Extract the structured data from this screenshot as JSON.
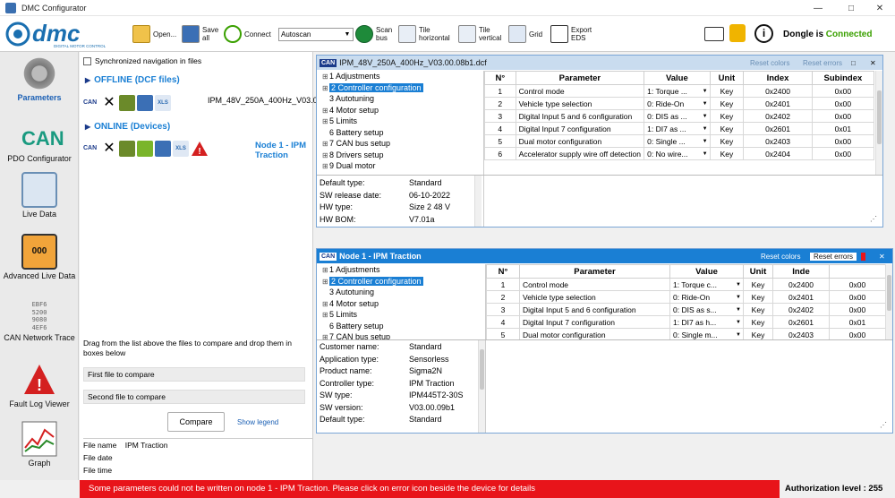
{
  "window": {
    "title": "DMC Configurator"
  },
  "toolbar": {
    "open": "Open...",
    "save_all": [
      "Save",
      "all"
    ],
    "connect": "Connect",
    "autoscan": "Autoscan",
    "scan_bus": [
      "Scan",
      "bus"
    ],
    "tile_horizontal": [
      "Tile",
      "horizontal"
    ],
    "tile_vertical": [
      "Tile",
      "vertical"
    ],
    "grid": "Grid",
    "export_eds": [
      "Export",
      "EDS"
    ],
    "dongle_label": "Dongle is",
    "dongle_status": "Connected",
    "logo_text": "dmc",
    "logo_sub": "DIGITAL MOTOR CONTROL"
  },
  "nav": [
    {
      "label": "Parameters",
      "icon": "gear-icon"
    },
    {
      "label": "PDO Configurator",
      "icon": "can-icon",
      "badge": "CAN"
    },
    {
      "label": "Live Data",
      "icon": "gauge-icon"
    },
    {
      "label": "Advanced Live Data",
      "icon": "display-icon",
      "screen": "000"
    },
    {
      "label": "CAN Network Trace",
      "icon": "hex-trace-icon",
      "hex": [
        "EBF6",
        "5200",
        "9080",
        "4EF6"
      ]
    },
    {
      "label": "Fault Log Viewer",
      "icon": "warning-icon"
    },
    {
      "label": "Graph",
      "icon": "graph-icon"
    }
  ],
  "files": {
    "sync_nav": "Synchronized navigation in files",
    "offline_title": "OFFLINE (DCF files)",
    "offline_file": "IPM_48V_250A_400Hz_V03.00.08b1.dcf",
    "online_title": "ONLINE (Devices)",
    "online_node": "Node 1 - IPM Traction",
    "can_tag": "CAN",
    "xls_tag": "XLS",
    "compare_help": "Drag from the list above the files to compare and drop them in boxes below",
    "first_file": "First file to compare",
    "second_file": "Second file to compare",
    "compare_btn": "Compare",
    "show_legend": "Show legend",
    "file_name_label": "File name",
    "file_name_value": "IPM Traction",
    "file_date_label": "File date",
    "file_time_label": "File time"
  },
  "tree": [
    "1 Adjustments",
    "2 Controller configuration",
    "3 Autotuning",
    "4 Motor setup",
    "5 Limits",
    "6 Battery setup",
    "7 CAN bus setup",
    "8 Drivers setup",
    "9 Dual motor"
  ],
  "columns": {
    "n": "N°",
    "param": "Parameter",
    "value": "Value",
    "unit": "Unit",
    "index": "Index",
    "subindex": "Subindex"
  },
  "top_window": {
    "title": "IPM_48V_250A_400Hz_V03.00.08b1.dcf",
    "can_tag": "CAN",
    "reset_colors": "Reset colors",
    "reset_errors": "Reset errors",
    "rows": [
      {
        "n": "1",
        "param": "Control mode",
        "value": "1: Torque ...",
        "unit": "Key",
        "index": "0x2400",
        "sub": "0x00"
      },
      {
        "n": "2",
        "param": "Vehicle type selection",
        "value": "0: Ride-On",
        "unit": "Key",
        "index": "0x2401",
        "sub": "0x00"
      },
      {
        "n": "3",
        "param": "Digital Input 5 and 6 configuration",
        "value": "0: DIS as ...",
        "unit": "Key",
        "index": "0x2402",
        "sub": "0x00"
      },
      {
        "n": "4",
        "param": "Digital Input 7 configuration",
        "value": "1: DI7 as ...",
        "unit": "Key",
        "index": "0x2601",
        "sub": "0x01"
      },
      {
        "n": "5",
        "param": "Dual motor configuration",
        "value": "0: Single ...",
        "unit": "Key",
        "index": "0x2403",
        "sub": "0x00"
      },
      {
        "n": "6",
        "param": "Accelerator supply wire off detection",
        "value": "0: No wire...",
        "unit": "Key",
        "index": "0x2404",
        "sub": "0x00"
      }
    ],
    "info": [
      {
        "k": "Default type:",
        "v": "Standard"
      },
      {
        "k": "SW release date:",
        "v": "06-10-2022"
      },
      {
        "k": "HW type:",
        "v": "Size 2 48 V"
      },
      {
        "k": "HW BOM:",
        "v": "V7.01a"
      }
    ]
  },
  "bottom_window": {
    "title": "Node 1 - IPM Traction",
    "can_tag": "CAN",
    "reset_colors": "Reset colors",
    "reset_errors": "Reset errors",
    "index_col": "Inde",
    "rows": [
      {
        "n": "1",
        "param": "Control mode",
        "value": "1: Torque c...",
        "unit": "Key",
        "index": "0x2400",
        "sub": "0x00"
      },
      {
        "n": "2",
        "param": "Vehicle type selection",
        "value": "0: Ride-On",
        "unit": "Key",
        "index": "0x2401",
        "sub": "0x00"
      },
      {
        "n": "3",
        "param": "Digital Input 5 and 6 configuration",
        "value": "0: DIS as s...",
        "unit": "Key",
        "index": "0x2402",
        "sub": "0x00"
      },
      {
        "n": "4",
        "param": "Digital Input 7 configuration",
        "value": "1: DI7 as h...",
        "unit": "Key",
        "index": "0x2601",
        "sub": "0x01"
      },
      {
        "n": "5",
        "param": "Dual motor configuration",
        "value": "0: Single m...",
        "unit": "Key",
        "index": "0x2403",
        "sub": "0x00"
      }
    ],
    "info": [
      {
        "k": "Customer name:",
        "v": "Standard"
      },
      {
        "k": "Application type:",
        "v": "Sensorless"
      },
      {
        "k": "Product name:",
        "v": "Sigma2N"
      },
      {
        "k": "Controller type:",
        "v": "IPM Traction"
      },
      {
        "k": "SW type:",
        "v": "IPM445T2-30S"
      },
      {
        "k": "SW version:",
        "v": "V03.00.09b1"
      },
      {
        "k": "Default type:",
        "v": "Standard"
      }
    ]
  },
  "status": {
    "message": "Some parameters could not be written on node 1 - IPM Traction. Please click on error icon beside the device for details",
    "auth": "Authorization level :  255"
  },
  "colors": {
    "accent": "#1a7fd4",
    "error": "#e8141a",
    "connected": "#3aa000",
    "header_active": "#1a7fd4"
  }
}
